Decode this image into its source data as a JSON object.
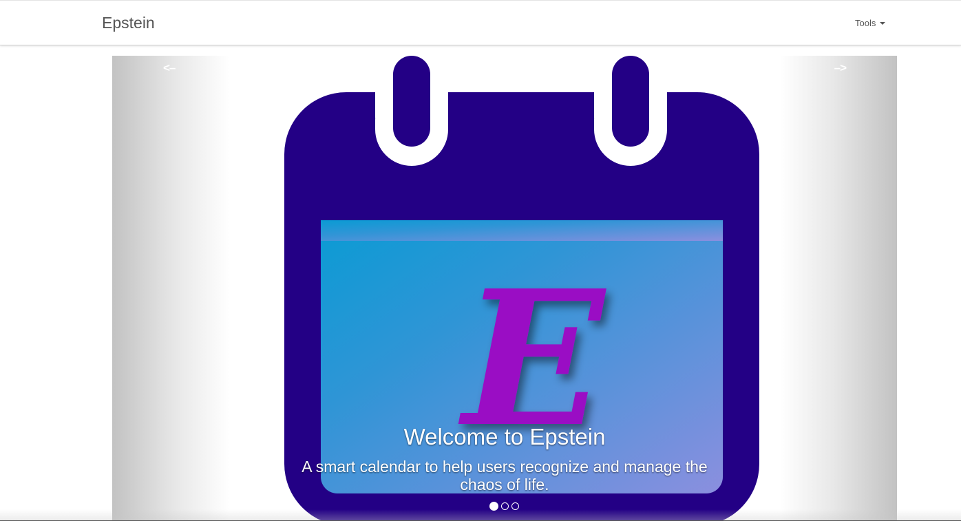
{
  "navbar": {
    "brand": "Epstein",
    "tools_label": "Tools"
  },
  "carousel": {
    "prev_label": "<–",
    "next_label": "–>",
    "slide": {
      "logo_letter": "E",
      "title": "Welcome to Epstein",
      "subtitle": "A smart calendar to help users recognize and manage the chaos of life."
    },
    "indicator_count": 3,
    "active_index": 0
  },
  "colors": {
    "calendar_body": "#230085",
    "letter": "#9a10c4",
    "screen_start": "#0a9bd4",
    "screen_end": "#8b8fdf"
  }
}
